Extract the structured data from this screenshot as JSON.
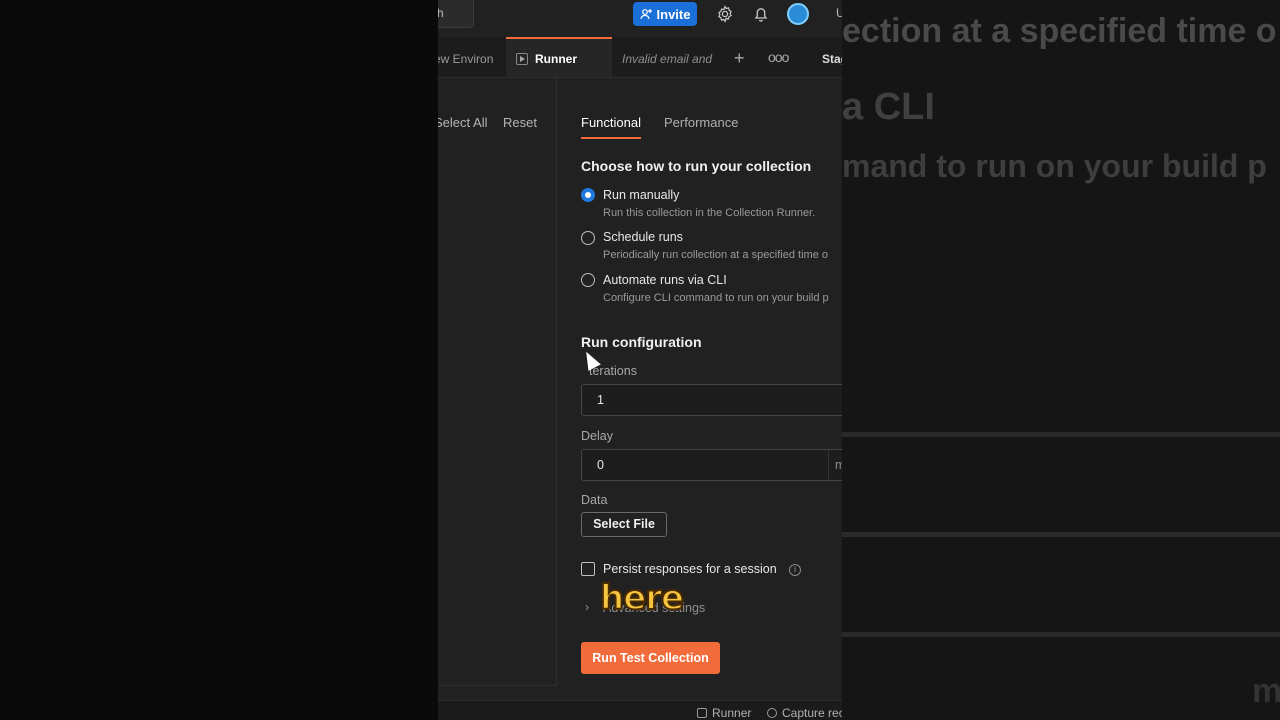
{
  "topbar": {
    "search_stub": "h",
    "invite_label": "Invite",
    "user_stub": "U"
  },
  "tabs": {
    "env": "ew Environ",
    "runner": "Runner",
    "invalid": "Invalid email and",
    "plus": "+",
    "more": "ooo",
    "stag": "Stag"
  },
  "left": {
    "select_all": "Select All",
    "reset": "Reset"
  },
  "runner": {
    "tabs": [
      "Functional",
      "Performance"
    ],
    "choose_heading": "Choose how to run your collection",
    "options": [
      {
        "title": "Run manually",
        "desc": "Run this collection in the Collection Runner."
      },
      {
        "title": "Schedule runs",
        "desc": "Periodically run collection at a specified time o"
      },
      {
        "title": "Automate runs via CLI",
        "desc": "Configure CLI command to run on your build p"
      }
    ],
    "config_heading": "Run configuration",
    "iterations_label": "terations",
    "iterations_value": "1",
    "delay_label": "Delay",
    "delay_value": "0",
    "delay_unit": "m",
    "data_label": "Data",
    "select_file": "Select File",
    "persist_label": "Persist responses for a session",
    "advanced_label": "Advanced settings",
    "overlay_word": "here",
    "run_button": "Run Test Collection"
  },
  "statusbar": {
    "runner": "Runner",
    "capture": "Capture rec"
  },
  "background": {
    "line1": "ection at a specified time o",
    "line2": "a CLI",
    "line3": "mand to run on your build p",
    "line4": "m"
  },
  "colors": {
    "accent": "#f26b3a",
    "invite": "#1a6fd8",
    "radio_on": "#1f7ae0",
    "overlay": "#f5c542"
  }
}
